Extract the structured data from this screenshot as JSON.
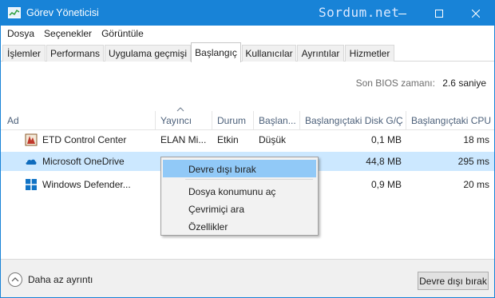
{
  "window": {
    "title": "Görev Yöneticisi",
    "watermark": "Sordum.net",
    "accent": "#1883d7"
  },
  "menu": [
    "Dosya",
    "Seçenekler",
    "Görüntüle"
  ],
  "tabs": [
    {
      "label": "İşlemler"
    },
    {
      "label": "Performans"
    },
    {
      "label": "Uygulama geçmişi"
    },
    {
      "label": "Başlangıç",
      "active": true
    },
    {
      "label": "Kullanıcılar"
    },
    {
      "label": "Ayrıntılar"
    },
    {
      "label": "Hizmetler"
    }
  ],
  "bios": {
    "label": "Son BIOS zamanı:",
    "value": "2.6 saniye"
  },
  "table": {
    "columns": [
      "Ad",
      "Yayıncı",
      "Durum",
      "Başlan...",
      "Başlangıçtaki Disk G/Ç",
      "Başlangıçtaki CPU"
    ],
    "sorted_column": "Yayıncı",
    "rows": [
      {
        "icon": "etd-control-center-icon",
        "name": "ETD Control Center",
        "publisher": "ELAN Mi...",
        "status": "Etkin",
        "impact": "Düşük",
        "disk": "0,1 MB",
        "cpu": "18 ms"
      },
      {
        "icon": "onedrive-cloud-icon",
        "name": "Microsoft OneDrive",
        "publisher": "",
        "status": "",
        "impact": "",
        "disk": "44,8 MB",
        "cpu": "295 ms",
        "selected": true
      },
      {
        "icon": "windows-defender-icon",
        "name": "Windows Defender...",
        "publisher": "",
        "status": "",
        "impact": "",
        "disk": "0,9 MB",
        "cpu": "20 ms"
      }
    ]
  },
  "context_menu": {
    "items": [
      "Devre dışı bırak",
      "Dosya konumunu aç",
      "Çevrimiçi ara",
      "Özellikler"
    ],
    "highlighted": "Devre dışı bırak",
    "highlight_color": "#91c9f7"
  },
  "footer": {
    "fewer_details": "Daha az ayrıntı",
    "disable_button": "Devre dışı bırak"
  },
  "colors": {
    "selected_row": "#cce8ff",
    "header_text": "#4c607a"
  }
}
